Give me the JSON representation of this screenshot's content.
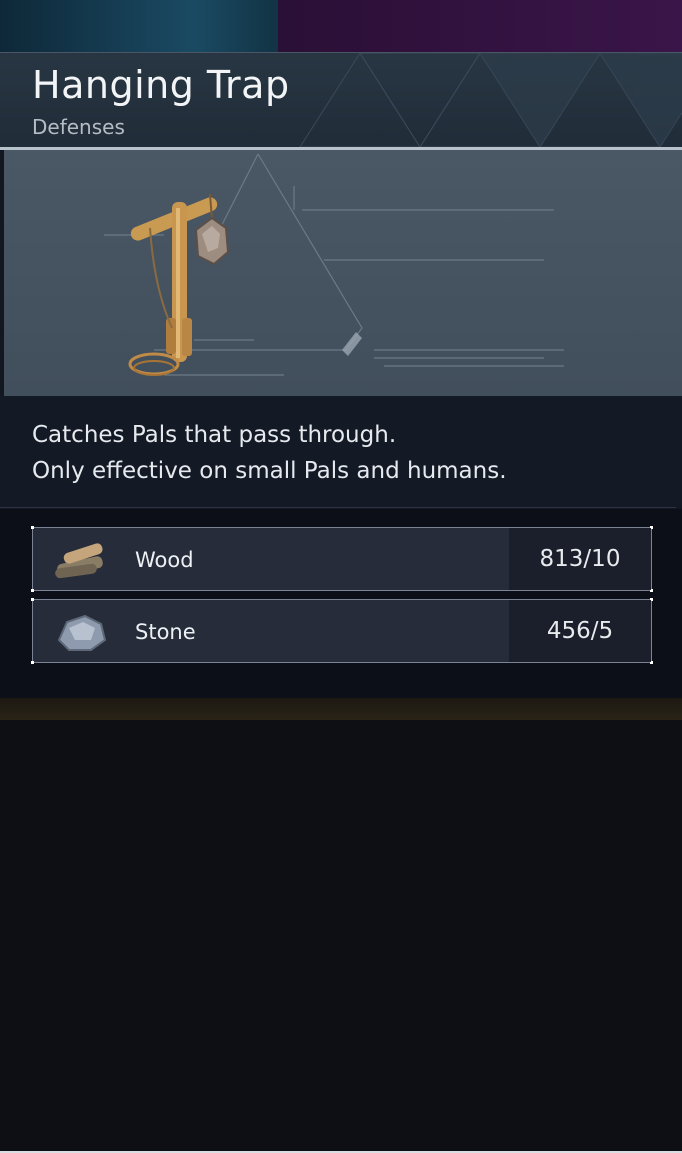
{
  "item": {
    "title": "Hanging Trap",
    "category": "Defenses",
    "image_icon": "hanging-trap-icon"
  },
  "description": {
    "line1": "Catches Pals that pass through.",
    "line2": "Only effective on small Pals and humans."
  },
  "materials": [
    {
      "name": "Wood",
      "icon": "wood-icon",
      "count": "813/10"
    },
    {
      "name": "Stone",
      "icon": "stone-icon",
      "count": "456/5"
    }
  ],
  "colors": {
    "panel": "#131722",
    "header": "#283643",
    "preview": "#4a5866",
    "text": "#f2f4f6"
  }
}
